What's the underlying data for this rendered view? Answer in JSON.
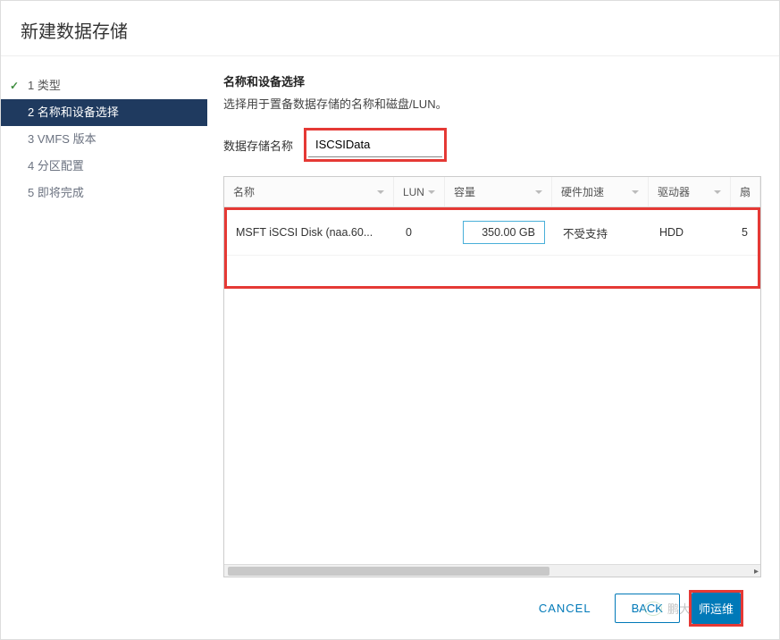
{
  "dialog": {
    "title": "新建数据存储"
  },
  "wizard": {
    "steps": [
      {
        "label": "1 类型",
        "state": "completed"
      },
      {
        "label": "2 名称和设备选择",
        "state": "active"
      },
      {
        "label": "3 VMFS 版本",
        "state": "pending"
      },
      {
        "label": "4 分区配置",
        "state": "pending"
      },
      {
        "label": "5 即将完成",
        "state": "pending"
      }
    ]
  },
  "panel": {
    "heading": "名称和设备选择",
    "subtext": "选择用于置备数据存储的名称和磁盘/LUN。"
  },
  "form": {
    "name_label": "数据存储名称",
    "name_value": "ISCSIData"
  },
  "table": {
    "columns": {
      "name": "名称",
      "lun": "LUN",
      "capacity": "容量",
      "hwaccel": "硬件加速",
      "drive": "驱动器",
      "ext": "扇"
    },
    "rows": [
      {
        "name": "MSFT iSCSI Disk (naa.60...",
        "lun": "0",
        "capacity": "350.00 GB",
        "hwaccel": "不受支持",
        "drive": "HDD",
        "ext": "5"
      }
    ]
  },
  "footer": {
    "cancel": "CANCEL",
    "back": "BACK",
    "next": "师运维"
  },
  "watermark": {
    "text": "鹏大"
  }
}
